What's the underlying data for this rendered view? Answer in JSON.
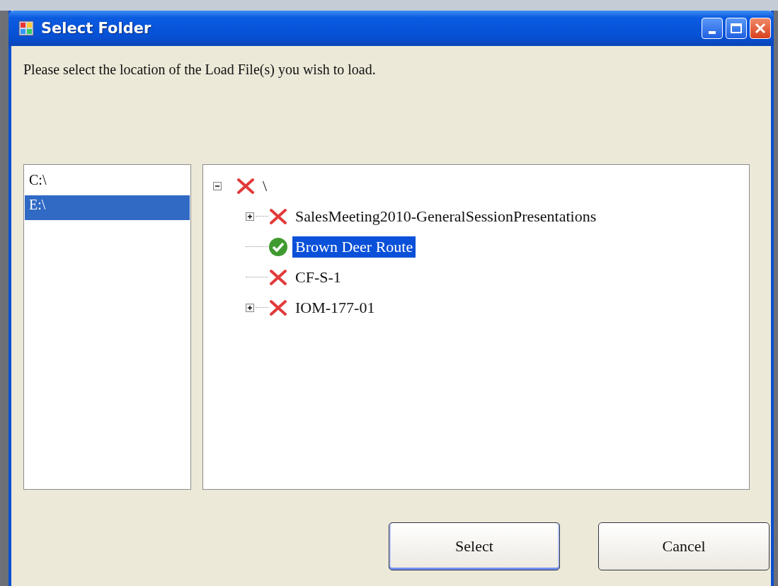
{
  "window": {
    "title": "Select Folder"
  },
  "prompt": "Please select the location of the Load File(s) you wish to load.",
  "drives": [
    {
      "label": "C:\\",
      "selected": false
    },
    {
      "label": "E:\\",
      "selected": true
    }
  ],
  "tree": [
    {
      "label": "\\",
      "valid": false,
      "expanded": true,
      "selected": false,
      "children": [
        {
          "label": "SalesMeeting2010-GeneralSessionPresentations",
          "valid": false,
          "expanded": false,
          "selected": false
        },
        {
          "label": "Brown Deer Route",
          "valid": true,
          "selected": true
        },
        {
          "label": "CF-S-1",
          "valid": false,
          "selected": false
        },
        {
          "label": "IOM-177-01",
          "valid": false,
          "expanded": false,
          "selected": false
        }
      ]
    }
  ],
  "buttons": [
    {
      "label": "Select",
      "default": true
    },
    {
      "label": "Cancel",
      "default": false
    }
  ]
}
